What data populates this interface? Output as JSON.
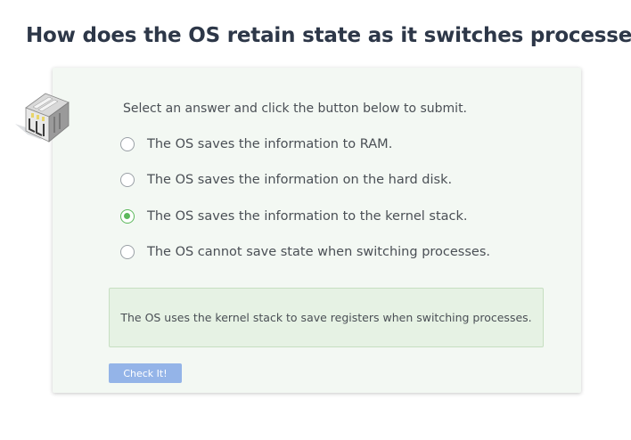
{
  "question": {
    "title": "How does the OS retain state as it switches processes?"
  },
  "card": {
    "logo_icon": "processor-cube-icon",
    "instructions": "Select an answer and click the button below to submit.",
    "options": [
      {
        "label": "The OS saves the information to RAM.",
        "selected": false
      },
      {
        "label": "The OS saves the information on the hard disk.",
        "selected": false
      },
      {
        "label": "The OS saves the information to the kernel stack.",
        "selected": true
      },
      {
        "label": "The OS cannot save state when switching processes.",
        "selected": false
      }
    ],
    "feedback": "The OS uses the kernel stack to save registers when switching processes.",
    "check_label": "Check It!"
  },
  "colors": {
    "accent_green": "#5cb85c",
    "button_blue": "#94b4e8",
    "card_bg": "#f3f8f3",
    "feedback_bg": "#e6f2e4",
    "title_text": "#2d3748"
  }
}
